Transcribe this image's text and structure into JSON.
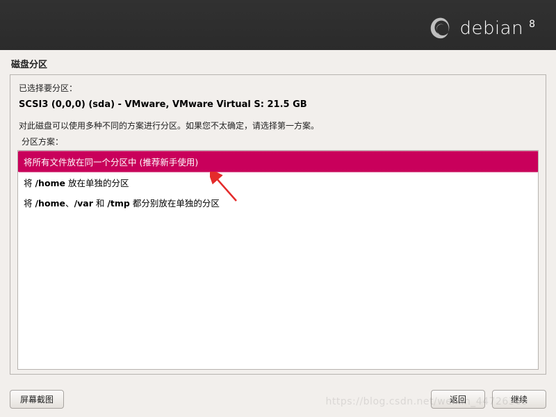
{
  "brand": {
    "name": "debian",
    "version": "8"
  },
  "page_title": "磁盘分区",
  "panel": {
    "selected_prefix": "已选择要分区：",
    "disk": "SCSI3 (0,0,0) (sda) - VMware, VMware Virtual S: 21.5 GB",
    "instruction": "对此磁盘可以使用多种不同的方案进行分区。如果您不太确定，请选择第一方案。",
    "scheme_label": "分区方案："
  },
  "options": [
    {
      "label": "将所有文件放在同一个分区中 (推荐新手使用)",
      "selected": true
    },
    {
      "label_html": "将 <b>/home</b> 放在单独的分区",
      "selected": false
    },
    {
      "label_html": "将 <b>/home</b>、<b>/var</b> 和 <b>/tmp</b> 都分别放在单独的分区",
      "selected": false
    }
  ],
  "buttons": {
    "screenshot": "屏幕截图",
    "back": "返回",
    "continue": "继续"
  },
  "watermark": "https://blog.csdn.net/weixin_44726369",
  "colors": {
    "accent": "#c9005b"
  }
}
